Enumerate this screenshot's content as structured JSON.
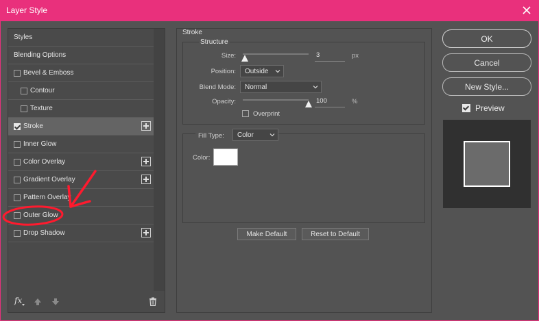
{
  "window": {
    "title": "Layer Style",
    "close_icon": "close-icon",
    "accent": "#e9307c"
  },
  "sidebar": {
    "items": [
      {
        "label": "Styles",
        "checkbox": false,
        "checked": false,
        "plus": false,
        "indent": 0,
        "selected": false
      },
      {
        "label": "Blending Options",
        "checkbox": false,
        "checked": false,
        "plus": false,
        "indent": 0,
        "selected": false
      },
      {
        "label": "Bevel & Emboss",
        "checkbox": true,
        "checked": false,
        "plus": false,
        "indent": 0,
        "selected": false
      },
      {
        "label": "Contour",
        "checkbox": true,
        "checked": false,
        "plus": false,
        "indent": 1,
        "selected": false
      },
      {
        "label": "Texture",
        "checkbox": true,
        "checked": false,
        "plus": false,
        "indent": 1,
        "selected": false
      },
      {
        "label": "Stroke",
        "checkbox": true,
        "checked": true,
        "plus": true,
        "indent": 0,
        "selected": true
      },
      {
        "label": "Inner Glow",
        "checkbox": true,
        "checked": false,
        "plus": false,
        "indent": 0,
        "selected": false
      },
      {
        "label": "Color Overlay",
        "checkbox": true,
        "checked": false,
        "plus": true,
        "indent": 0,
        "selected": false
      },
      {
        "label": "Gradient Overlay",
        "checkbox": true,
        "checked": false,
        "plus": true,
        "indent": 0,
        "selected": false
      },
      {
        "label": "Pattern Overlay",
        "checkbox": true,
        "checked": false,
        "plus": false,
        "indent": 0,
        "selected": false
      },
      {
        "label": "Outer Glow",
        "checkbox": true,
        "checked": false,
        "plus": false,
        "indent": 0,
        "selected": false
      },
      {
        "label": "Drop Shadow",
        "checkbox": true,
        "checked": false,
        "plus": true,
        "indent": 0,
        "selected": false
      }
    ],
    "footer": {
      "fx_label": "fx"
    }
  },
  "stroke": {
    "title": "Stroke",
    "structure": {
      "title": "Structure",
      "size_label": "Size:",
      "size_value": "3",
      "size_unit": "px",
      "size_fraction": 0.03,
      "position_label": "Position:",
      "position_value": "Outside",
      "blend_mode_label": "Blend Mode:",
      "blend_mode_value": "Normal",
      "opacity_label": "Opacity:",
      "opacity_value": "100",
      "opacity_unit": "%",
      "opacity_fraction": 1.0,
      "overprint_label": "Overprint",
      "overprint_checked": false
    },
    "fill": {
      "fill_type_label": "Fill Type:",
      "fill_type_value": "Color",
      "color_label": "Color:",
      "color_value": "#ffffff"
    },
    "make_default_label": "Make Default",
    "reset_default_label": "Reset to Default"
  },
  "actions": {
    "ok_label": "OK",
    "cancel_label": "Cancel",
    "new_style_label": "New Style...",
    "preview_label": "Preview",
    "preview_checked": true
  },
  "annotation_color": "#ff1a2e"
}
